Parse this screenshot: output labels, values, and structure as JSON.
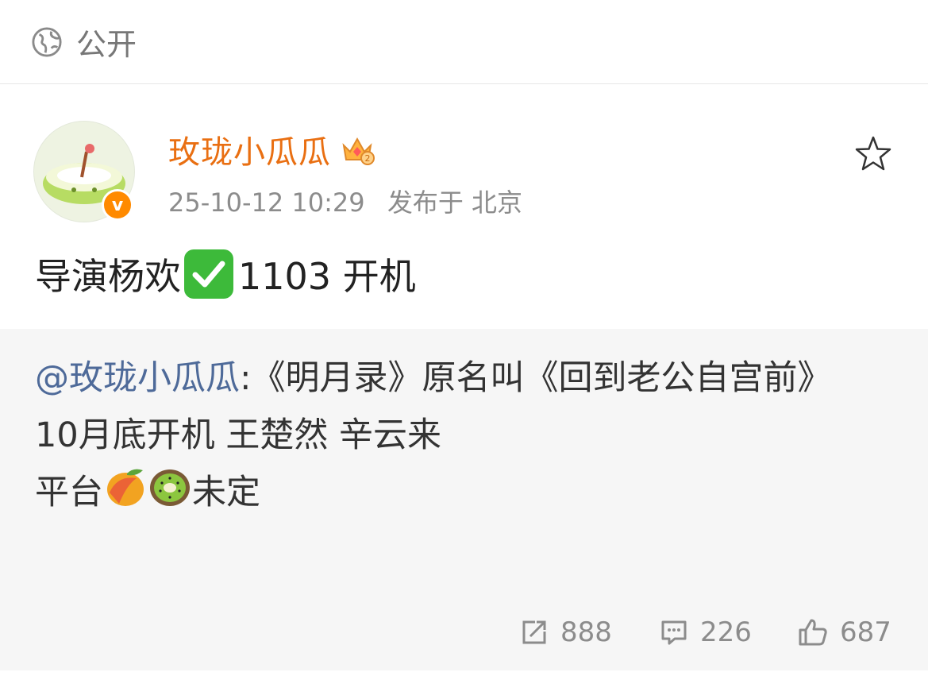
{
  "header": {
    "visibility": "公开",
    "visibility_icon": "globe-icon"
  },
  "post": {
    "author": "玫珑小瓜瓜",
    "timestamp": "25-10-12 10:29",
    "location_prefix": "发布于",
    "location": "北京",
    "content_before": "导演杨欢",
    "content_after": "1103 开机",
    "author_color": "#e96f12"
  },
  "repost": {
    "mention": "@玫珑小瓜瓜",
    "line1": ":《明月录》原名叫《回到老公自宫前》",
    "line2": "10月底开机 王楚然 辛云来",
    "line3_before": "平台",
    "line3_after": "未定"
  },
  "actions": {
    "reposts": "888",
    "comments": "226",
    "likes": "687"
  }
}
